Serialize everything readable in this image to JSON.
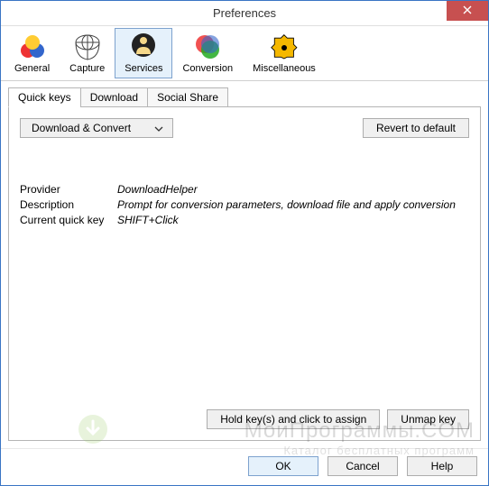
{
  "window": {
    "title": "Preferences"
  },
  "toolbar": {
    "items": [
      {
        "label": "General"
      },
      {
        "label": "Capture"
      },
      {
        "label": "Services"
      },
      {
        "label": "Conversion"
      },
      {
        "label": "Miscellaneous"
      }
    ],
    "active_index": 2
  },
  "tabs": {
    "items": [
      {
        "label": "Quick keys"
      },
      {
        "label": "Download"
      },
      {
        "label": "Social Share"
      }
    ],
    "active_index": 0
  },
  "panel": {
    "dropdown_selected": "Download & Convert",
    "revert_button": "Revert to default",
    "details": {
      "provider_label": "Provider",
      "provider_value": "DownloadHelper",
      "description_label": "Description",
      "description_value": "Prompt for conversion parameters, download file and apply conversion",
      "quickkey_label": "Current quick key",
      "quickkey_value": "SHIFT+Click"
    },
    "assign_button": "Hold key(s) and click to assign",
    "unmap_button": "Unmap key"
  },
  "footer": {
    "ok": "OK",
    "cancel": "Cancel",
    "help": "Help"
  },
  "watermark": {
    "line1": "МоиПрограммы.COM",
    "line2": "Каталог бесплатных программ"
  }
}
